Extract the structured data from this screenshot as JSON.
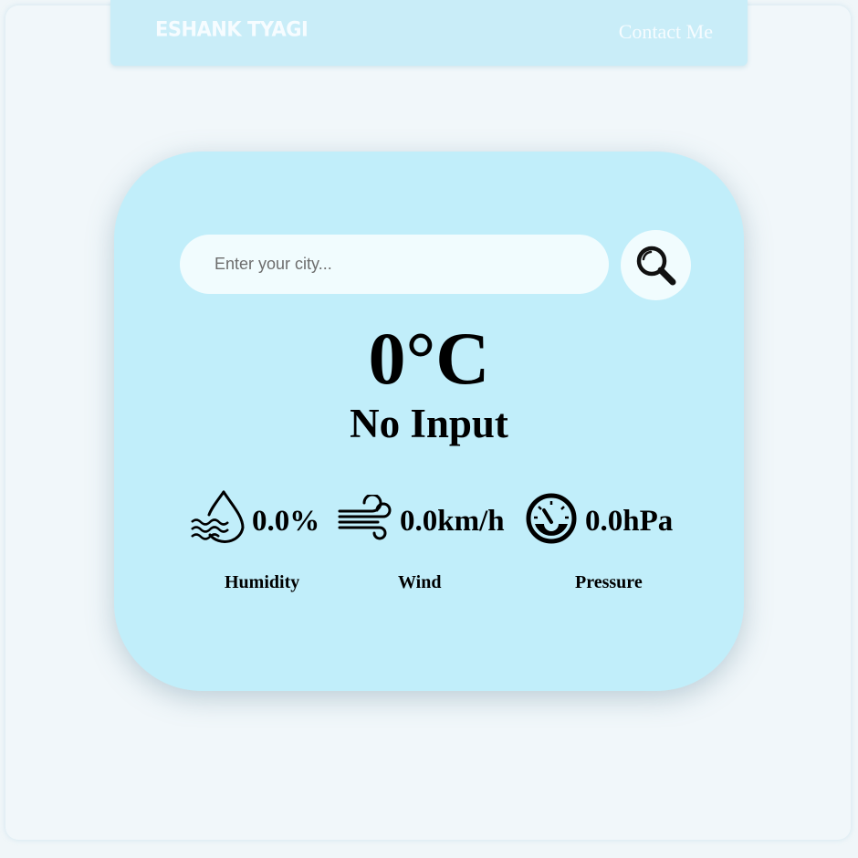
{
  "navbar": {
    "brand": "ESHANK TYAGI",
    "contact_label": "Contact Me"
  },
  "search": {
    "placeholder": "Enter your city...",
    "value": "",
    "button_icon": "search-icon"
  },
  "weather": {
    "temperature": "0°C",
    "city": "No Input",
    "metrics": [
      {
        "icon": "humidity-icon",
        "value": "0.0%",
        "label": "Humidity"
      },
      {
        "icon": "wind-icon",
        "value": "0.0km/h",
        "label": "Wind"
      },
      {
        "icon": "pressure-gauge-icon",
        "value": "0.0hPa",
        "label": "Pressure"
      }
    ]
  },
  "colors": {
    "page_background": "#f0f6f9",
    "navbar_background": "#c9edf8",
    "card_background": "#c1eefa",
    "input_background": "#f1fcfe",
    "text": "#000000"
  }
}
